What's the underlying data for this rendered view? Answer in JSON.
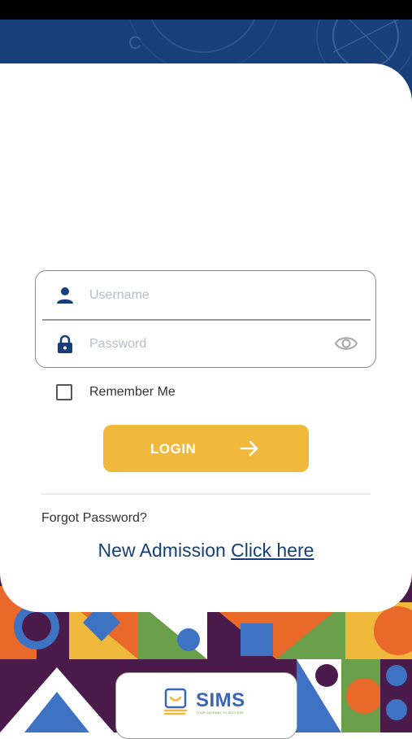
{
  "login_form": {
    "username_placeholder": "Username",
    "password_placeholder": "Password",
    "remember_label": "Remember Me",
    "login_label": "LOGIN"
  },
  "links": {
    "forgot_password": "Forgot Password?",
    "admission_prefix": "New Admission ",
    "admission_link": "Click here"
  },
  "brand": {
    "name": "SIMS",
    "tagline": "YOUR GATEWAY TO SUCCESS"
  },
  "colors": {
    "primary_blue": "#17407a",
    "accent_yellow": "#f1b93b",
    "link_blue": "#183f73"
  },
  "icons": {
    "username": "person-icon",
    "password": "lock-icon",
    "visibility": "eye-icon",
    "submit": "arrow-right-icon"
  }
}
